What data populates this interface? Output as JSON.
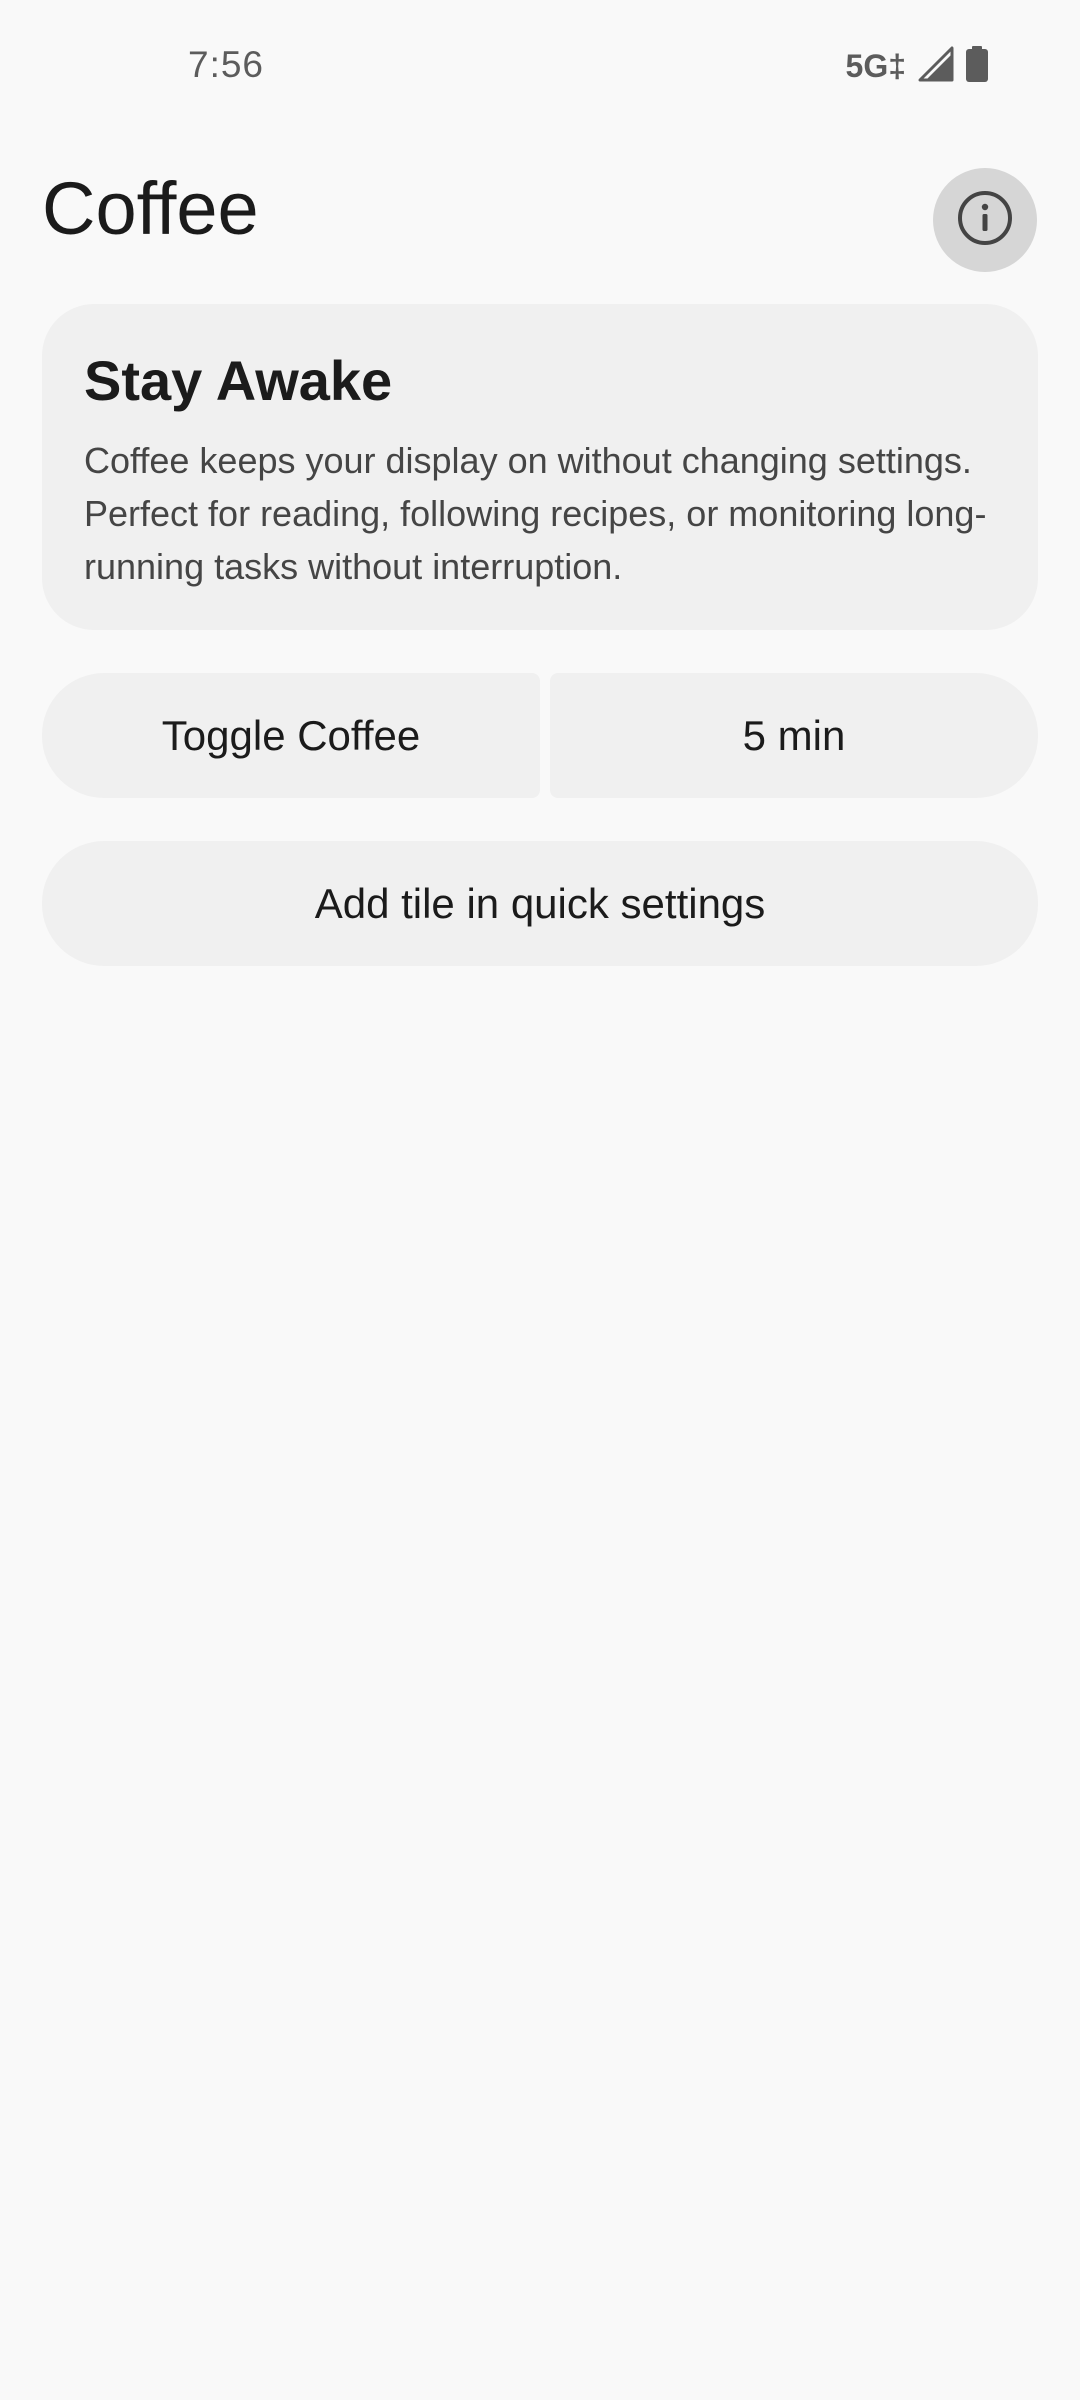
{
  "status_bar": {
    "time": "7:56",
    "network": "5G‡",
    "icons": [
      "signal-icon",
      "battery-icon"
    ]
  },
  "header": {
    "title": "Coffee",
    "info_icon": "info-icon"
  },
  "card": {
    "title": "Stay Awake",
    "body": "Coffee keeps your display on without changing settings. Perfect for reading, following recipes, or monitoring long-running tasks without interruption."
  },
  "controls": {
    "toggle_label": "Toggle Coffee",
    "duration_label": "5 min",
    "add_tile_label": "Add tile in quick settings"
  },
  "colors": {
    "background": "#f9f9f9",
    "surface": "#f0f0f0",
    "info_button": "#d6d6d6"
  }
}
